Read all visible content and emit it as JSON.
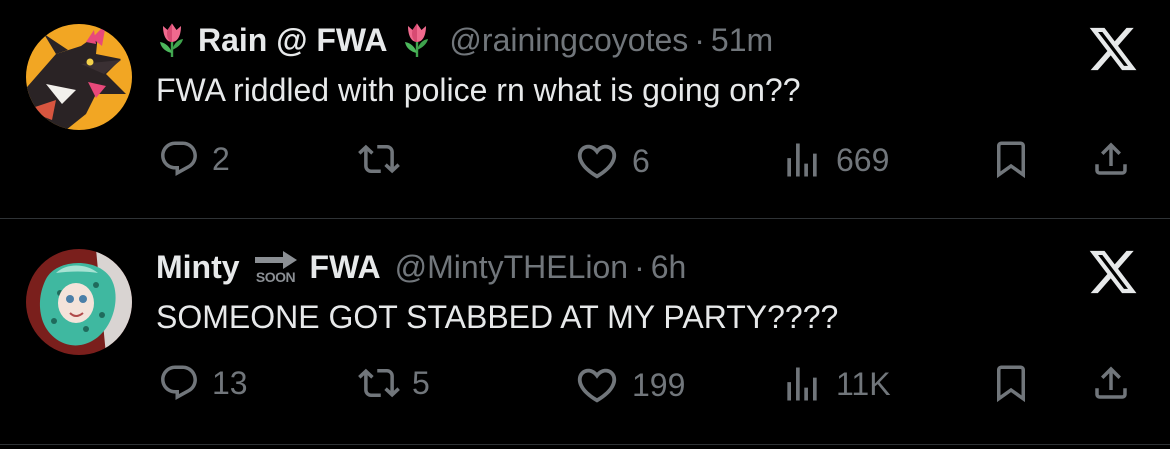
{
  "colors": {
    "background": "#000000",
    "primary_text": "#e7e9ea",
    "secondary_text": "#71767b",
    "divider": "#2f3336"
  },
  "tweets": [
    {
      "display_name": "Rain @ FWA",
      "name_emoji": "tulip",
      "handle": "@rainingcoyotes",
      "separator": "·",
      "time": "51m",
      "text": "FWA riddled with police rn what is going on??",
      "replies": "2",
      "retweets": "",
      "likes": "6",
      "views": "669",
      "icons": [
        "reply-icon",
        "retweet-icon",
        "like-icon",
        "views-icon",
        "bookmark-icon",
        "share-icon",
        "x-logo-icon"
      ]
    },
    {
      "display_name_prefix": "Minty",
      "soon_label": "SOON",
      "display_name_suffix": "FWA",
      "handle": "@MintyTHELion",
      "separator": "·",
      "time": "6h",
      "text": "SOMEONE GOT STABBED AT MY PARTY????",
      "replies": "13",
      "retweets": "5",
      "likes": "199",
      "views": "11K",
      "icons": [
        "reply-icon",
        "retweet-icon",
        "like-icon",
        "views-icon",
        "bookmark-icon",
        "share-icon",
        "x-logo-icon"
      ]
    }
  ]
}
